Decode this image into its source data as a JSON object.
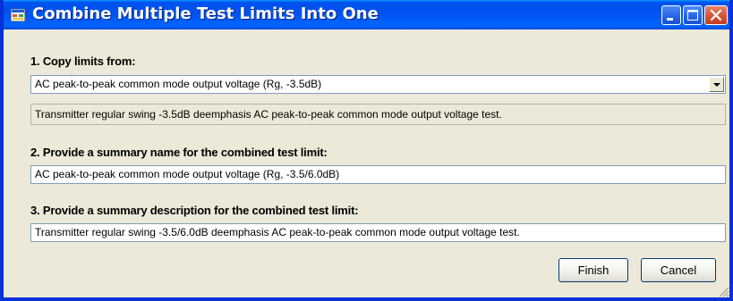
{
  "window": {
    "title": "Combine Multiple Test Limits Into One",
    "controls": [
      "minimize-icon",
      "maximize-icon",
      "close-icon"
    ]
  },
  "section1": {
    "label": "1. Copy limits from:",
    "selected": "AC peak-to-peak common mode output voltage (Rg, -3.5dB)",
    "description": "Transmitter regular swing -3.5dB deemphasis AC peak-to-peak common mode output voltage test."
  },
  "section2": {
    "label": "2. Provide a summary name for the combined test limit:",
    "value": "AC peak-to-peak common mode output voltage (Rg, -3.5/6.0dB)"
  },
  "section3": {
    "label": "3. Provide a summary description for the combined test limit:",
    "value": "Transmitter regular swing -3.5/6.0dB deemphasis AC peak-to-peak common mode output voltage test."
  },
  "buttons": {
    "finish": "Finish",
    "cancel": "Cancel"
  },
  "colors": {
    "titlebar": "#0053ee",
    "window_bg": "#ece9d8",
    "border": "#0831d9"
  }
}
